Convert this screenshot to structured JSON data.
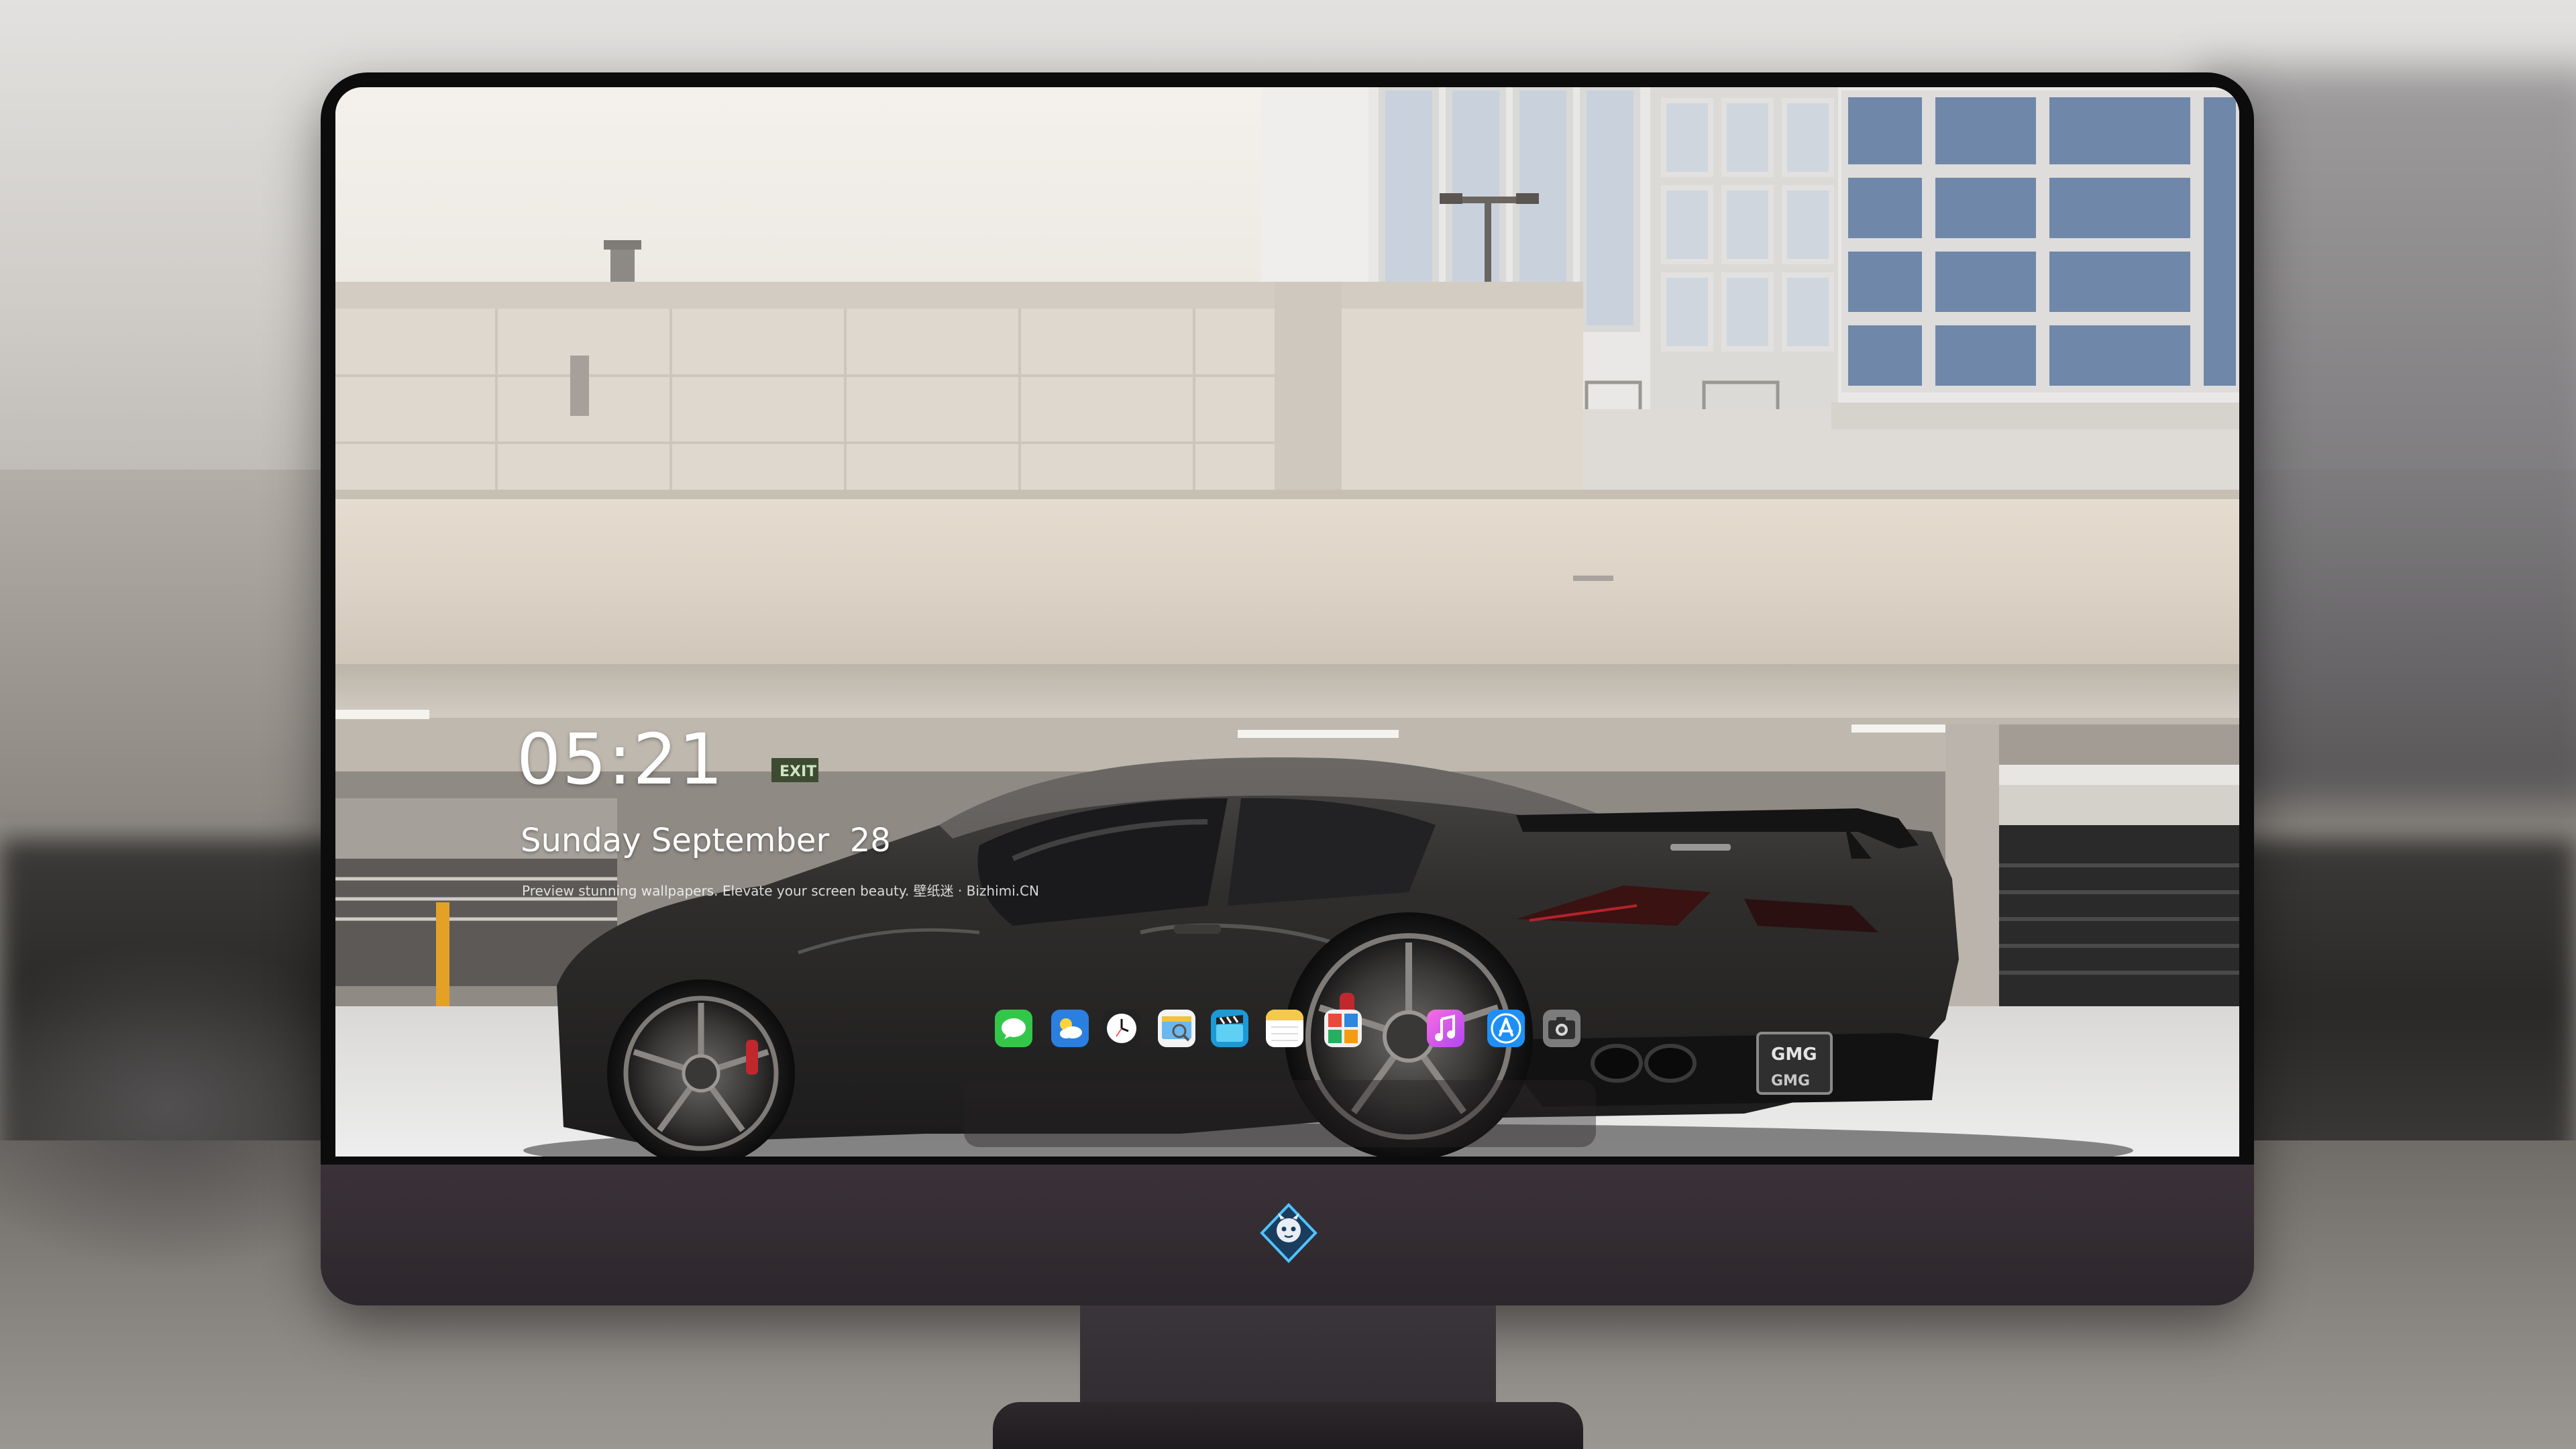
{
  "lockscreen": {
    "time": "05:21",
    "date": "Sunday September  28",
    "tagline": "Preview stunning wallpapers. Elevate your screen beauty. 壁纸迷 · Bizhimi.CN"
  },
  "dock": {
    "apps": [
      {
        "name": "Messages",
        "icon": "messages-icon"
      },
      {
        "name": "Weather",
        "icon": "weather-icon"
      },
      {
        "name": "Clock",
        "icon": "clock-icon"
      },
      {
        "name": "Preview",
        "icon": "preview-icon"
      },
      {
        "name": "Clips",
        "icon": "clapperboard-icon"
      },
      {
        "name": "Notes",
        "icon": "notes-icon"
      },
      {
        "name": "Photo Booth",
        "icon": "photo-collage-icon"
      },
      {
        "name": "iTunes",
        "icon": "music-note-icon"
      },
      {
        "name": "App Store",
        "icon": "app-store-icon"
      },
      {
        "name": "Camera",
        "icon": "camera-icon"
      }
    ]
  },
  "wallpaper": {
    "subject": "matte black sports car parked under a concrete parking structure",
    "plate_text": "GMG",
    "exit_sign": "EXIT"
  },
  "colors": {
    "bezel": "#0d0c0d",
    "chin": "#332d32",
    "dock": "#262224",
    "car_body": "#2b2a2a",
    "concrete": "#dcd6cc"
  }
}
